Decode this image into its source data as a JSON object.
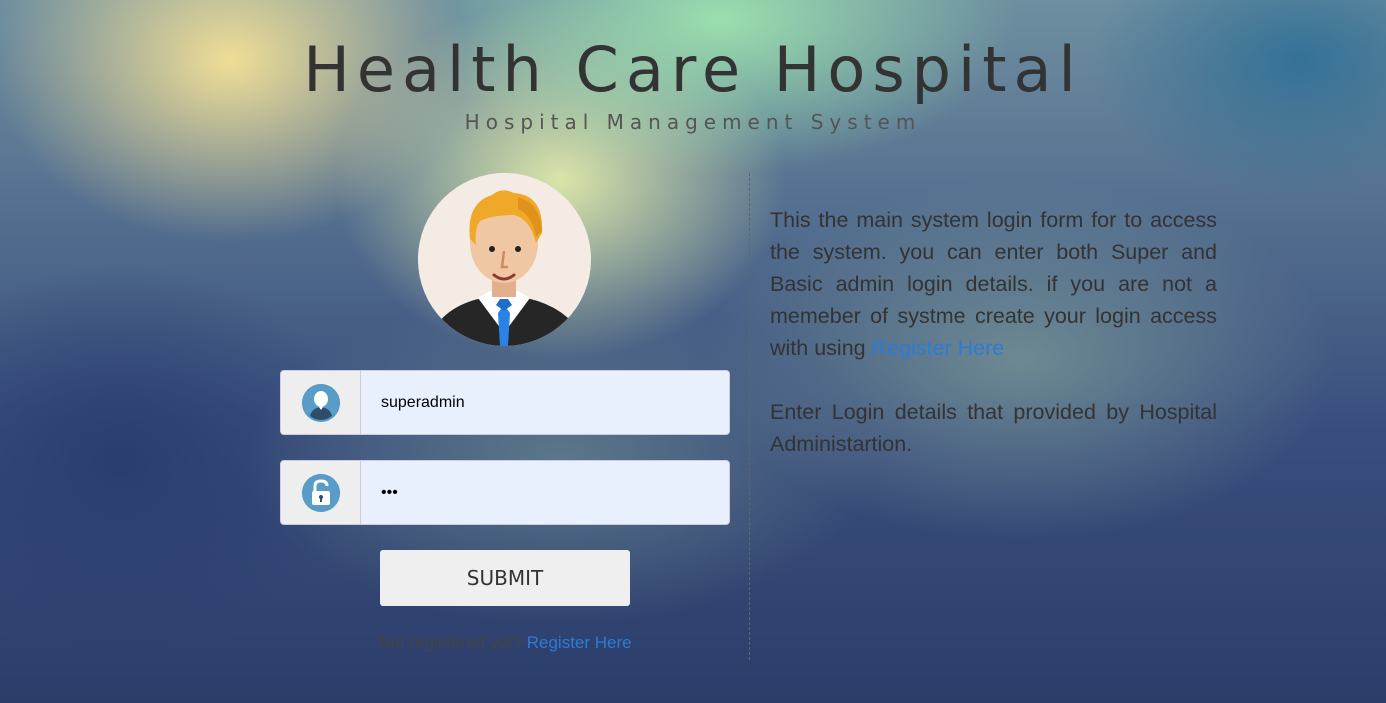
{
  "header": {
    "title": "Health Care Hospital",
    "subtitle": "Hospital Management System"
  },
  "login": {
    "username_value": "superadmin",
    "password_value": "123",
    "submit_label": "SUBMIT",
    "not_registered_text": "Not registered yet?",
    "register_link": "Register Here"
  },
  "info": {
    "paragraph1": "This the main system login form for to access the system. you can enter both Super and Basic admin login details. if you are not a memeber of systme create your login access with using",
    "paragraph1_link": "Register Here",
    "paragraph2": "Enter Login details that provided by Hospital Administartion."
  },
  "icons": {
    "avatar": "doctor-avatar-icon",
    "username": "user-icon",
    "password": "unlock-icon"
  },
  "colors": {
    "link": "#2a7cd6",
    "icon_accent": "#5a9cc8"
  }
}
